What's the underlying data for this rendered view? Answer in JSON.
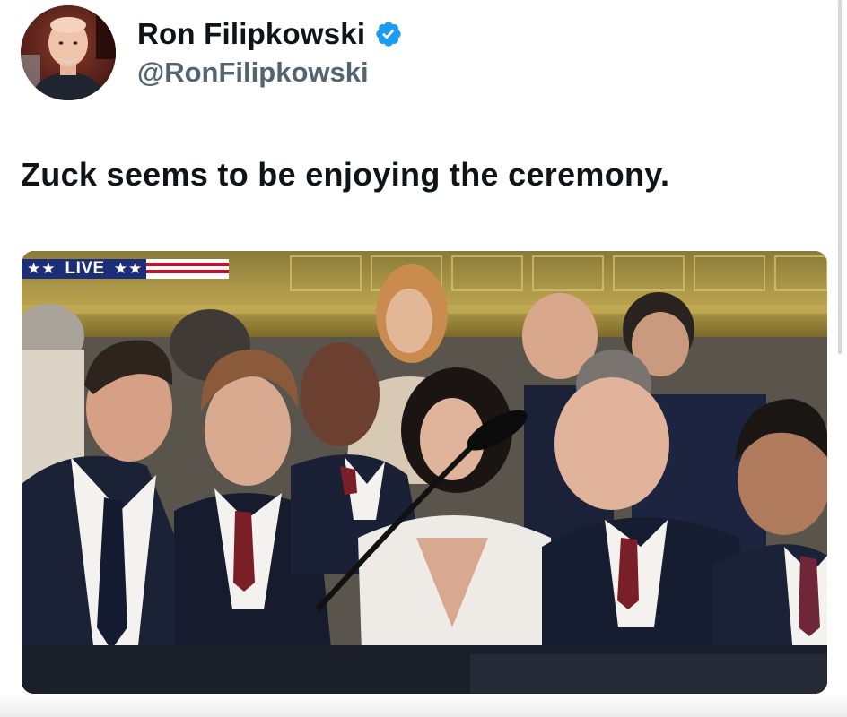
{
  "author": {
    "display_name": "Ron Filipkowski",
    "handle": "@RonFilipkowski",
    "verified": true,
    "verified_icon": "verified-badge-icon",
    "verified_color": "#1d9bf0"
  },
  "tweet": {
    "text": "Zuck seems to be enjoying the ceremony."
  },
  "media": {
    "live_label": "LIVE",
    "live_stars_left": "★★",
    "live_stars_right": "★★",
    "live_bar_color": "#1c2e78"
  },
  "colors": {
    "name_text": "#0f1419",
    "handle_text": "#536471",
    "background": "#ffffff"
  }
}
